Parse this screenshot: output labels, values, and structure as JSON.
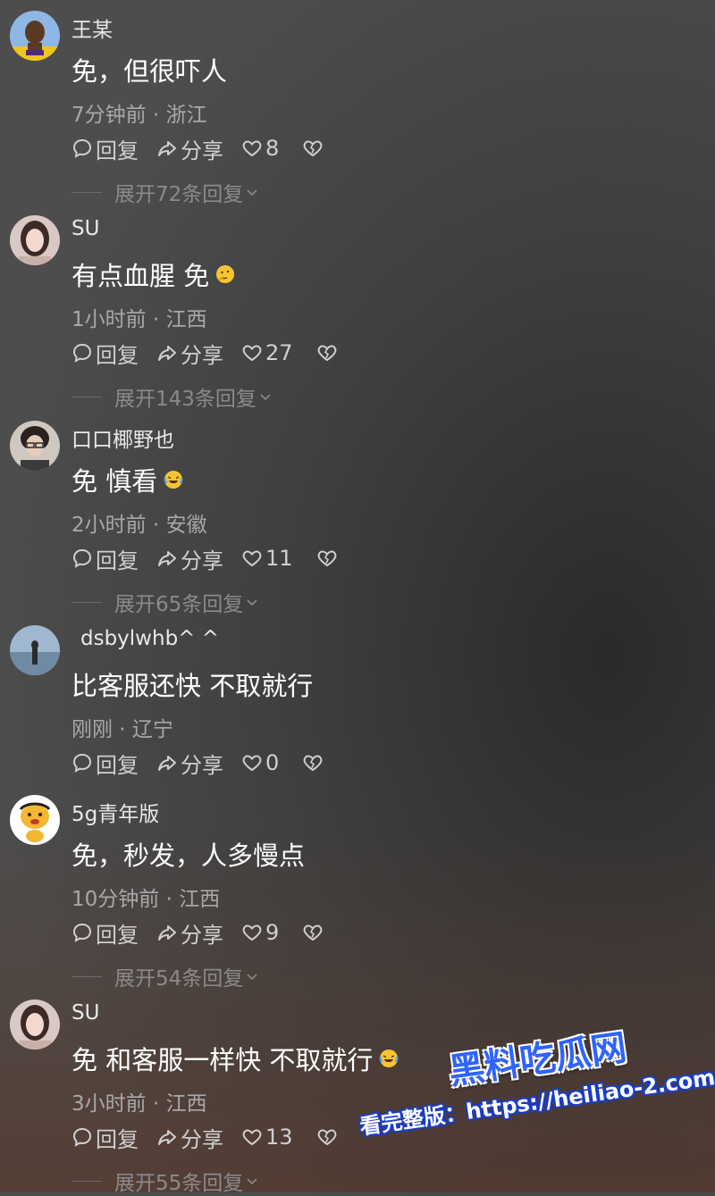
{
  "comments": [
    {
      "avatar": "avatar-basketball-player",
      "username": "王某",
      "content": "免，但很吓人",
      "emoji": "",
      "meta": "7分钟前 · 浙江",
      "reply_label": "回复",
      "share_label": "分享",
      "likes": "8",
      "replies": "展开72条回复"
    },
    {
      "avatar": "avatar-woman",
      "username": "SU",
      "content": "有点血腥 免",
      "emoji": "thinking-face-emoji",
      "meta": "1小时前 · 江西",
      "reply_label": "回复",
      "share_label": "分享",
      "likes": "27",
      "replies": "展开143条回复"
    },
    {
      "avatar": "avatar-man-glasses",
      "username": "口口椰野也",
      "content": "免 慎看",
      "emoji": "laughing-crying-emoji",
      "meta": "2小时前 · 安徽",
      "reply_label": "回复",
      "share_label": "分享",
      "likes": "11",
      "replies": "展开65条回复"
    },
    {
      "avatar": "avatar-seaside",
      "username": "dsbylwhb^ ^",
      "content": "比客服还快 不取就行",
      "emoji": "",
      "meta": "刚刚 · 辽宁",
      "reply_label": "回复",
      "share_label": "分享",
      "likes": "0",
      "replies": ""
    },
    {
      "avatar": "avatar-cartoon",
      "username": "5g青年版",
      "content": "免，秒发，人多慢点",
      "emoji": "",
      "meta": "10分钟前 · 江西",
      "reply_label": "回复",
      "share_label": "分享",
      "likes": "9",
      "replies": "展开54条回复"
    },
    {
      "avatar": "avatar-woman",
      "username": "SU",
      "content": "免 和客服一样快 不取就行",
      "emoji": "laughing-crying-emoji",
      "meta": "3小时前 · 江西",
      "reply_label": "回复",
      "share_label": "分享",
      "likes": "13",
      "replies": "展开55条回复"
    }
  ],
  "watermark": {
    "title": "黑料吃瓜网",
    "url": "看完整版：https://heiliao-2.com"
  },
  "colors": {
    "accent_blue": "#2e63ff",
    "meta_gray": "#a8a8a8",
    "reply_gray": "#8a8a8a"
  }
}
